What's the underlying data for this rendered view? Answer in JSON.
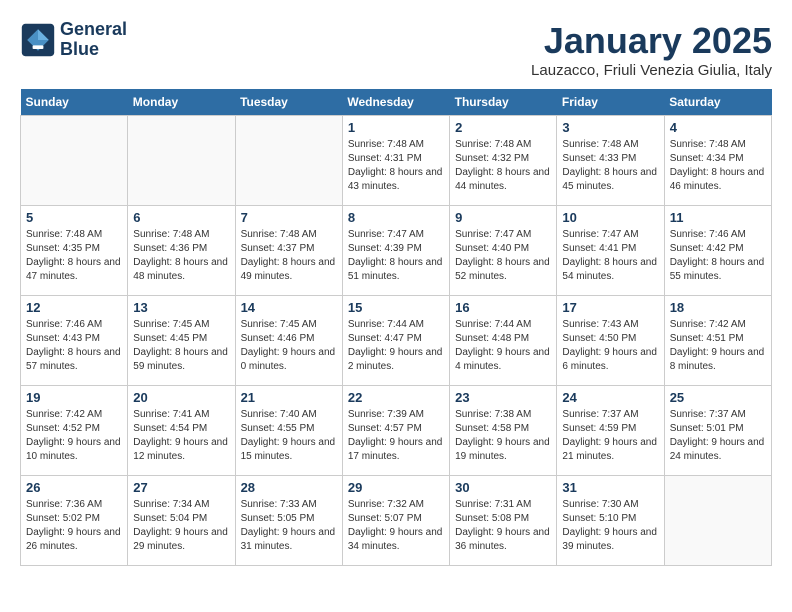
{
  "header": {
    "logo_line1": "General",
    "logo_line2": "Blue",
    "month": "January 2025",
    "location": "Lauzacco, Friuli Venezia Giulia, Italy"
  },
  "days_of_week": [
    "Sunday",
    "Monday",
    "Tuesday",
    "Wednesday",
    "Thursday",
    "Friday",
    "Saturday"
  ],
  "weeks": [
    [
      {
        "day": "",
        "info": ""
      },
      {
        "day": "",
        "info": ""
      },
      {
        "day": "",
        "info": ""
      },
      {
        "day": "1",
        "info": "Sunrise: 7:48 AM\nSunset: 4:31 PM\nDaylight: 8 hours and 43 minutes."
      },
      {
        "day": "2",
        "info": "Sunrise: 7:48 AM\nSunset: 4:32 PM\nDaylight: 8 hours and 44 minutes."
      },
      {
        "day": "3",
        "info": "Sunrise: 7:48 AM\nSunset: 4:33 PM\nDaylight: 8 hours and 45 minutes."
      },
      {
        "day": "4",
        "info": "Sunrise: 7:48 AM\nSunset: 4:34 PM\nDaylight: 8 hours and 46 minutes."
      }
    ],
    [
      {
        "day": "5",
        "info": "Sunrise: 7:48 AM\nSunset: 4:35 PM\nDaylight: 8 hours and 47 minutes."
      },
      {
        "day": "6",
        "info": "Sunrise: 7:48 AM\nSunset: 4:36 PM\nDaylight: 8 hours and 48 minutes."
      },
      {
        "day": "7",
        "info": "Sunrise: 7:48 AM\nSunset: 4:37 PM\nDaylight: 8 hours and 49 minutes."
      },
      {
        "day": "8",
        "info": "Sunrise: 7:47 AM\nSunset: 4:39 PM\nDaylight: 8 hours and 51 minutes."
      },
      {
        "day": "9",
        "info": "Sunrise: 7:47 AM\nSunset: 4:40 PM\nDaylight: 8 hours and 52 minutes."
      },
      {
        "day": "10",
        "info": "Sunrise: 7:47 AM\nSunset: 4:41 PM\nDaylight: 8 hours and 54 minutes."
      },
      {
        "day": "11",
        "info": "Sunrise: 7:46 AM\nSunset: 4:42 PM\nDaylight: 8 hours and 55 minutes."
      }
    ],
    [
      {
        "day": "12",
        "info": "Sunrise: 7:46 AM\nSunset: 4:43 PM\nDaylight: 8 hours and 57 minutes."
      },
      {
        "day": "13",
        "info": "Sunrise: 7:45 AM\nSunset: 4:45 PM\nDaylight: 8 hours and 59 minutes."
      },
      {
        "day": "14",
        "info": "Sunrise: 7:45 AM\nSunset: 4:46 PM\nDaylight: 9 hours and 0 minutes."
      },
      {
        "day": "15",
        "info": "Sunrise: 7:44 AM\nSunset: 4:47 PM\nDaylight: 9 hours and 2 minutes."
      },
      {
        "day": "16",
        "info": "Sunrise: 7:44 AM\nSunset: 4:48 PM\nDaylight: 9 hours and 4 minutes."
      },
      {
        "day": "17",
        "info": "Sunrise: 7:43 AM\nSunset: 4:50 PM\nDaylight: 9 hours and 6 minutes."
      },
      {
        "day": "18",
        "info": "Sunrise: 7:42 AM\nSunset: 4:51 PM\nDaylight: 9 hours and 8 minutes."
      }
    ],
    [
      {
        "day": "19",
        "info": "Sunrise: 7:42 AM\nSunset: 4:52 PM\nDaylight: 9 hours and 10 minutes."
      },
      {
        "day": "20",
        "info": "Sunrise: 7:41 AM\nSunset: 4:54 PM\nDaylight: 9 hours and 12 minutes."
      },
      {
        "day": "21",
        "info": "Sunrise: 7:40 AM\nSunset: 4:55 PM\nDaylight: 9 hours and 15 minutes."
      },
      {
        "day": "22",
        "info": "Sunrise: 7:39 AM\nSunset: 4:57 PM\nDaylight: 9 hours and 17 minutes."
      },
      {
        "day": "23",
        "info": "Sunrise: 7:38 AM\nSunset: 4:58 PM\nDaylight: 9 hours and 19 minutes."
      },
      {
        "day": "24",
        "info": "Sunrise: 7:37 AM\nSunset: 4:59 PM\nDaylight: 9 hours and 21 minutes."
      },
      {
        "day": "25",
        "info": "Sunrise: 7:37 AM\nSunset: 5:01 PM\nDaylight: 9 hours and 24 minutes."
      }
    ],
    [
      {
        "day": "26",
        "info": "Sunrise: 7:36 AM\nSunset: 5:02 PM\nDaylight: 9 hours and 26 minutes."
      },
      {
        "day": "27",
        "info": "Sunrise: 7:34 AM\nSunset: 5:04 PM\nDaylight: 9 hours and 29 minutes."
      },
      {
        "day": "28",
        "info": "Sunrise: 7:33 AM\nSunset: 5:05 PM\nDaylight: 9 hours and 31 minutes."
      },
      {
        "day": "29",
        "info": "Sunrise: 7:32 AM\nSunset: 5:07 PM\nDaylight: 9 hours and 34 minutes."
      },
      {
        "day": "30",
        "info": "Sunrise: 7:31 AM\nSunset: 5:08 PM\nDaylight: 9 hours and 36 minutes."
      },
      {
        "day": "31",
        "info": "Sunrise: 7:30 AM\nSunset: 5:10 PM\nDaylight: 9 hours and 39 minutes."
      },
      {
        "day": "",
        "info": ""
      }
    ]
  ]
}
